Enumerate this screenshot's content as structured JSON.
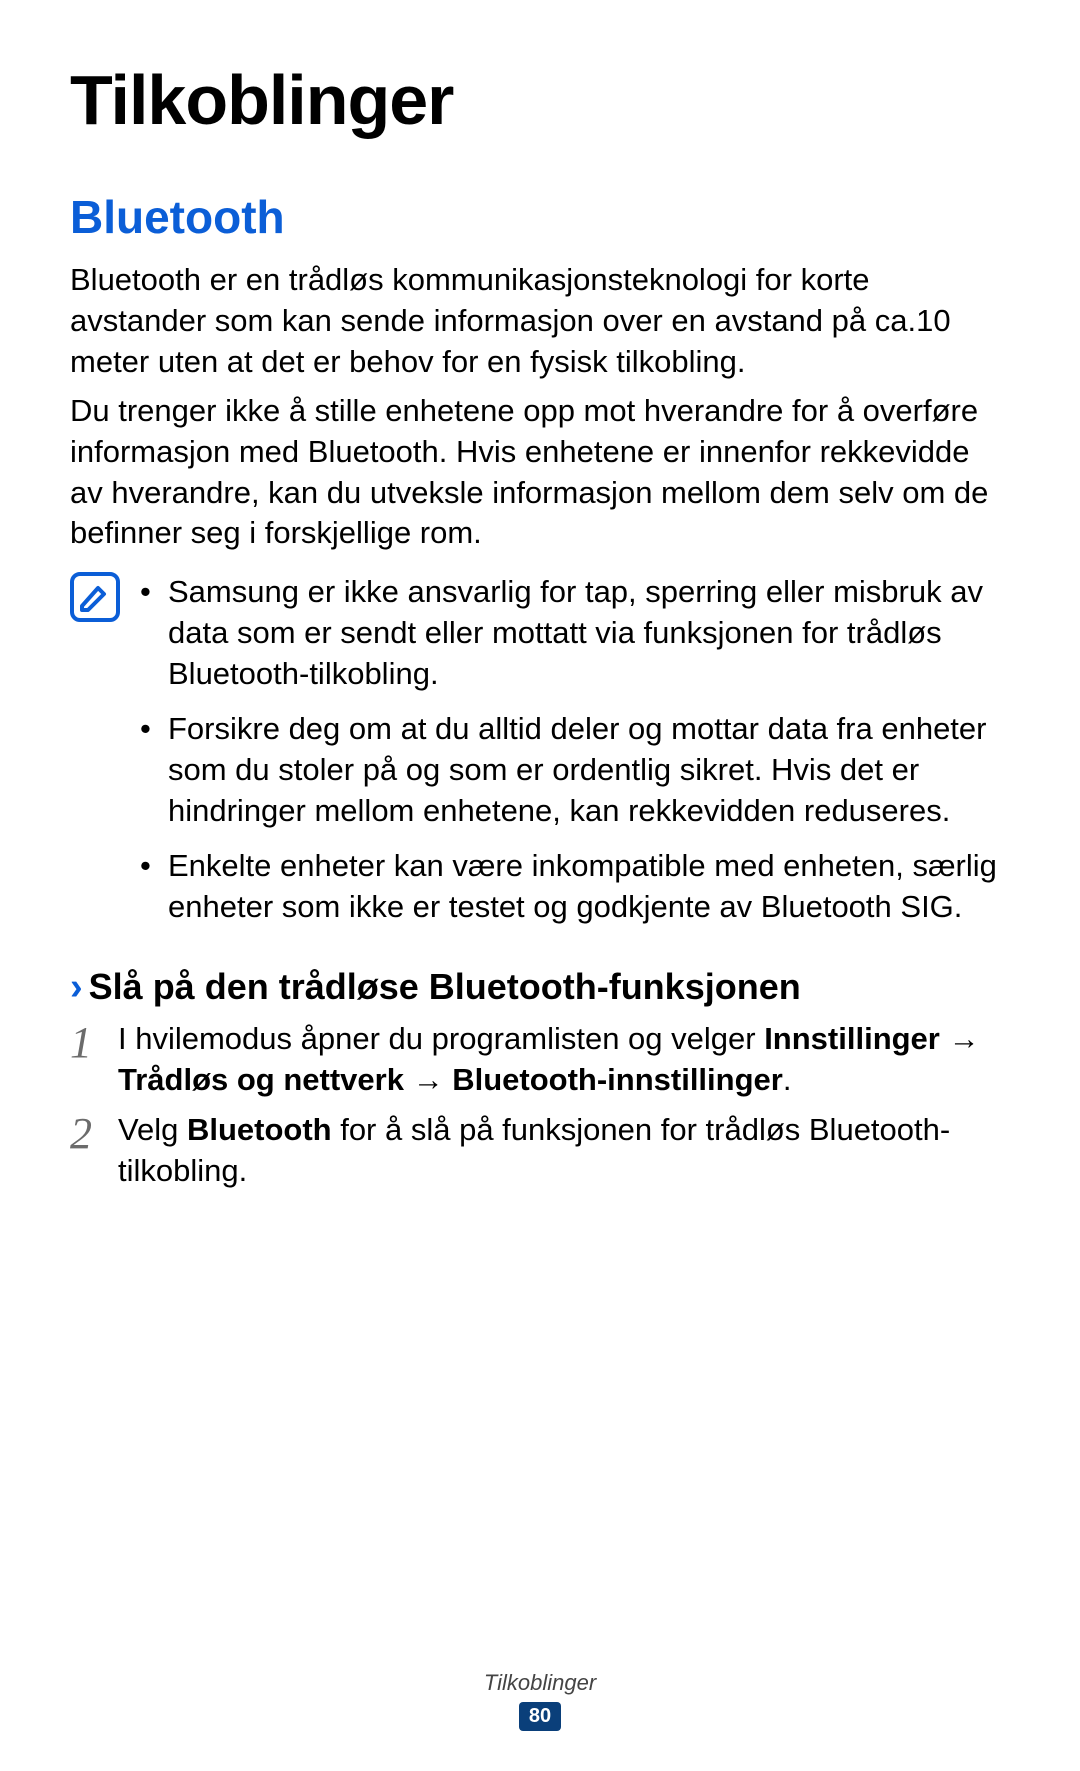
{
  "title": "Tilkoblinger",
  "section_title": "Bluetooth",
  "para1": "Bluetooth er en trådløs kommunikasjonsteknologi for korte avstander som kan sende informasjon over en avstand på ca.10 meter uten at det er behov for en fysisk tilkobling.",
  "para2": "Du trenger ikke å stille enhetene opp mot hverandre for å overføre informasjon med Bluetooth. Hvis enhetene er innenfor rekkevidde av hverandre, kan du utveksle informasjon mellom dem selv om de befinner seg i forskjellige rom.",
  "notes": [
    "Samsung er ikke ansvarlig for tap, sperring eller misbruk av data som er sendt eller mottatt via funksjonen for trådløs Bluetooth-tilkobling.",
    "Forsikre deg om at du alltid deler og mottar data fra enheter som du stoler på og som er ordentlig sikret. Hvis det er hindringer mellom enhetene, kan rekkevidden reduseres.",
    "Enkelte enheter kan være inkompatible med enheten, særlig enheter som ikke er testet og godkjente av Bluetooth SIG."
  ],
  "subheading": "Slå på den trådløse Bluetooth-funksjonen",
  "steps": {
    "s1": {
      "num": "1",
      "pre": "I hvilemodus åpner du programlisten og velger ",
      "b1": "Innstillinger",
      "arrow1": " → ",
      "b2": "Trådløs og nettverk",
      "arrow2": " → ",
      "b3": "Bluetooth-innstillinger",
      "post": "."
    },
    "s2": {
      "num": "2",
      "pre": "Velg ",
      "b1": "Bluetooth",
      "post": " for å slå på funksjonen for trådløs Bluetooth-tilkobling."
    }
  },
  "footer_label": "Tilkoblinger",
  "page_number": "80"
}
